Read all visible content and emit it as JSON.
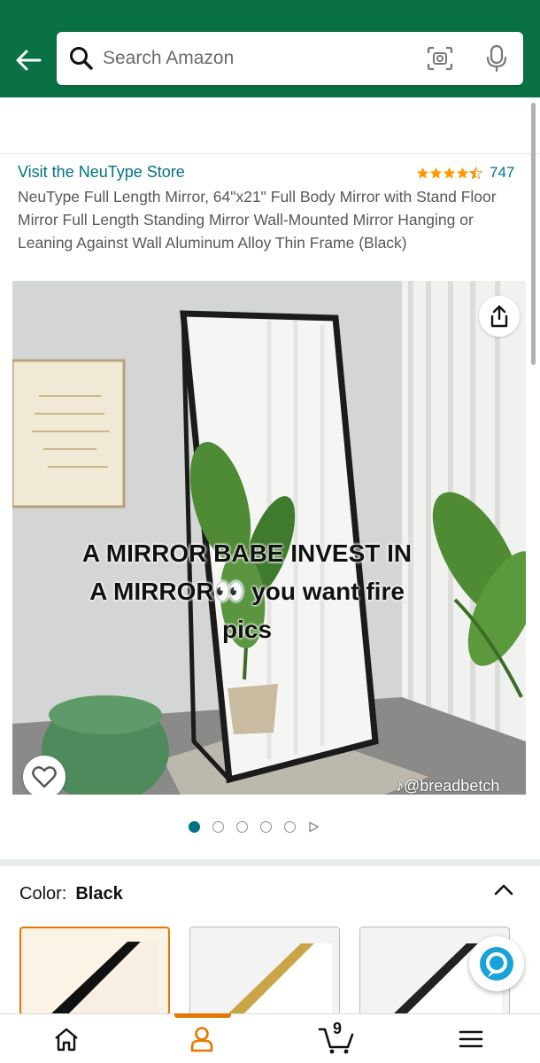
{
  "header": {
    "search_placeholder": "Search Amazon",
    "icons": [
      "back-arrow-icon",
      "search-icon",
      "camera-scan-icon",
      "microphone-icon"
    ],
    "brand_color": "#0a7144"
  },
  "product": {
    "store_link": "Visit the NeuType Store",
    "rating_stars": 4.5,
    "rating_count": "747",
    "title": "NeuType Full Length Mirror, 64\"x21\" Full Body Mirror with Stand Floor Mirror Full Length Standing Mirror Wall-Mounted Mirror Hanging or Leaning Against Wall Aluminum Alloy Thin Frame (Black)"
  },
  "gallery": {
    "caption_line1": "A MIRROR BABE INVEST IN",
    "caption_line2": "A MIRROR👀 you want fire",
    "caption_line3": "pics",
    "watermark": "♪@breadbetch",
    "dot_count": 5,
    "active_index": 0
  },
  "variation": {
    "label": "Color:",
    "value": "Black"
  },
  "bottom_nav": {
    "items": [
      "home-icon",
      "account-icon",
      "cart-icon",
      "menu-icon"
    ],
    "cart_count": "9",
    "active_item": "account",
    "accent_color": "#e77600"
  },
  "link_color": "#007185",
  "star_color": "#ff9900"
}
